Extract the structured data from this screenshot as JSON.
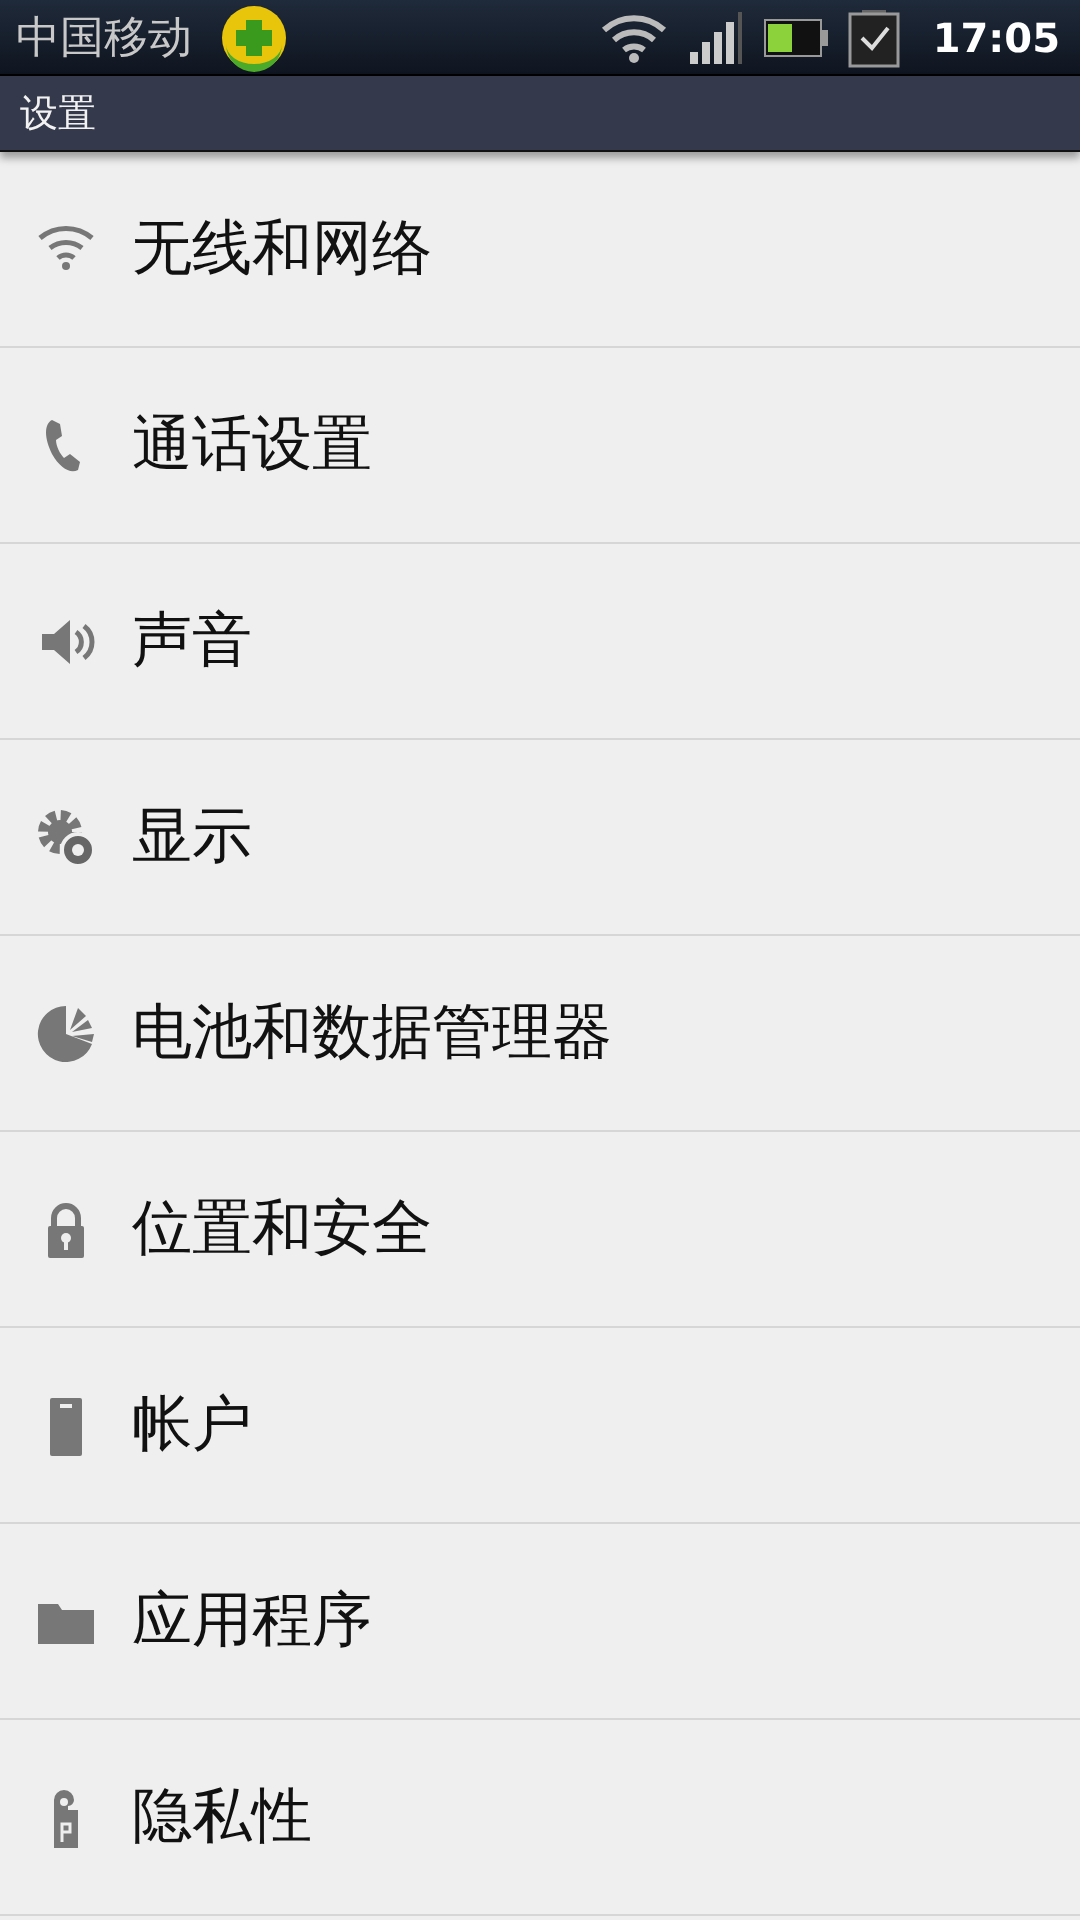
{
  "status_bar": {
    "carrier": "中国移动",
    "time": "17:05"
  },
  "title_bar": {
    "title": "设置"
  },
  "settings": [
    {
      "label": "无线和网络"
    },
    {
      "label": "通话设置"
    },
    {
      "label": "声音"
    },
    {
      "label": "显示"
    },
    {
      "label": "电池和数据管理器"
    },
    {
      "label": "位置和安全"
    },
    {
      "label": "帐户"
    },
    {
      "label": "应用程序"
    },
    {
      "label": "隐私性"
    }
  ]
}
